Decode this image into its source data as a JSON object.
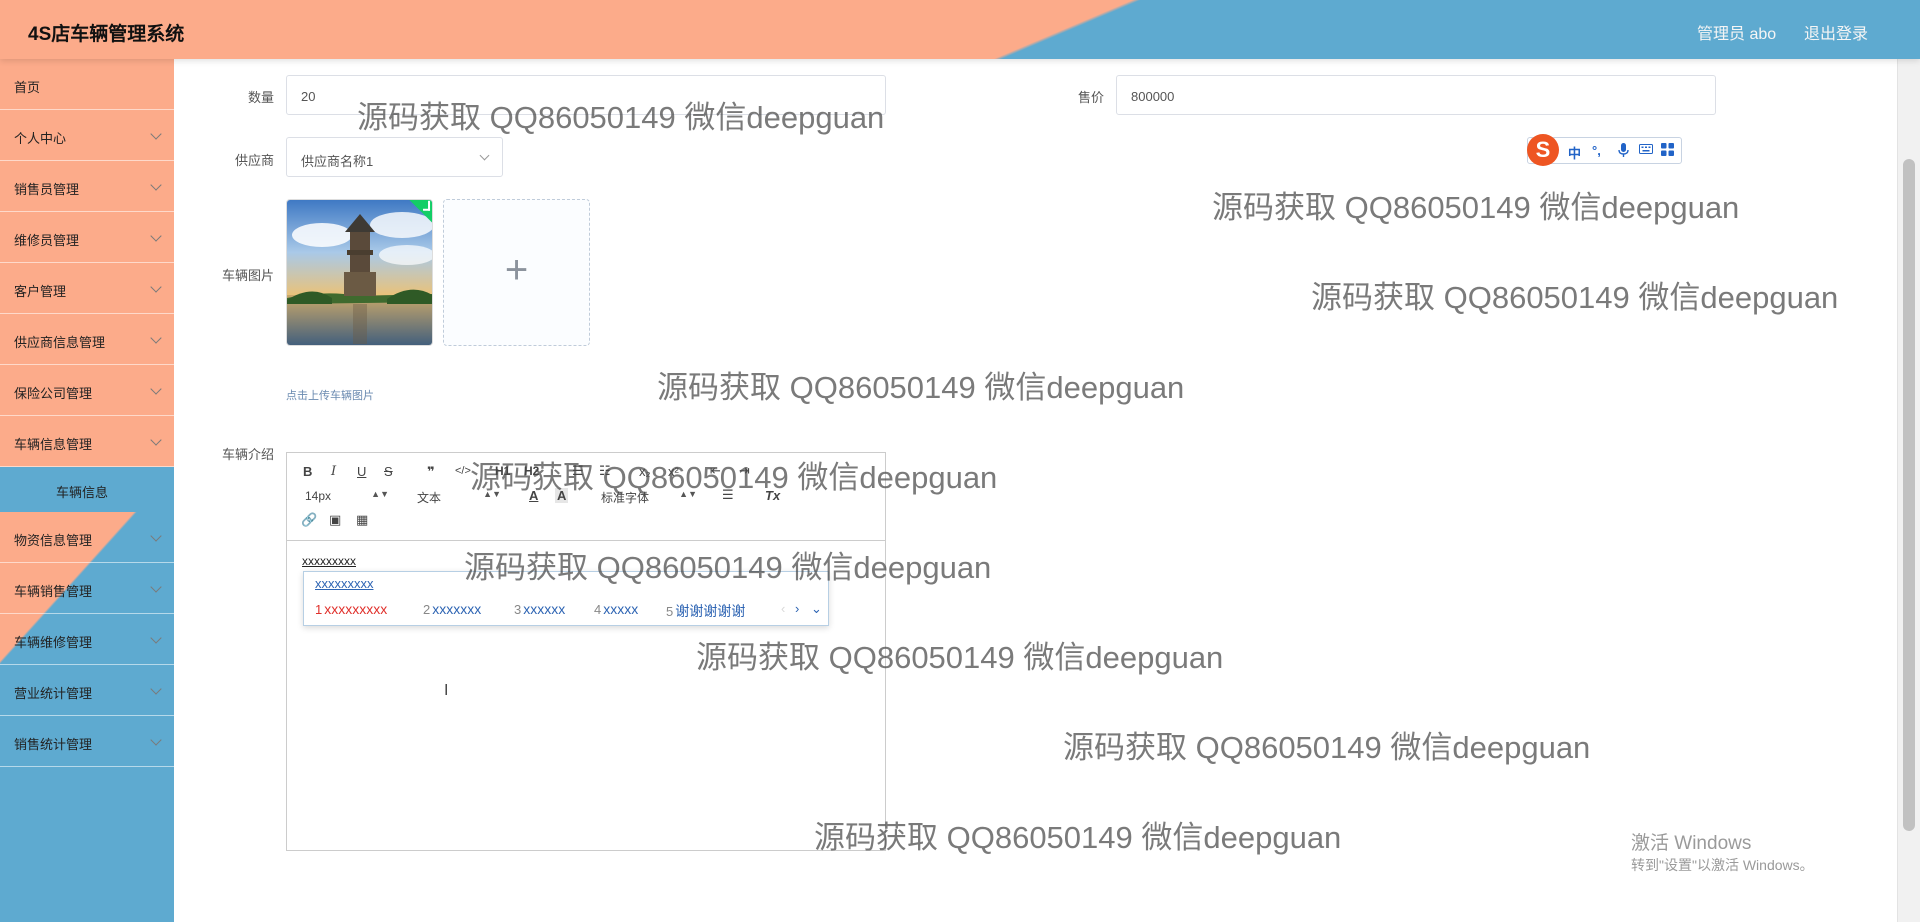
{
  "header": {
    "title": "4S店车辆管理系统",
    "user": "管理员 abo",
    "logout": "退出登录"
  },
  "sidebar": {
    "items": [
      {
        "label": "首页",
        "has_children": false
      },
      {
        "label": "个人中心",
        "has_children": true
      },
      {
        "label": "销售员管理",
        "has_children": true
      },
      {
        "label": "维修员管理",
        "has_children": true
      },
      {
        "label": "客户管理",
        "has_children": true
      },
      {
        "label": "供应商信息管理",
        "has_children": true
      },
      {
        "label": "保险公司管理",
        "has_children": true
      },
      {
        "label": "车辆信息管理",
        "has_children": true
      },
      {
        "label": "车辆信息",
        "submenu": true,
        "active": true
      },
      {
        "label": "物资信息管理",
        "has_children": true
      },
      {
        "label": "车辆销售管理",
        "has_children": true
      },
      {
        "label": "车辆维修管理",
        "has_children": true
      },
      {
        "label": "营业统计管理",
        "has_children": true
      },
      {
        "label": "销售统计管理",
        "has_children": true
      }
    ]
  },
  "form": {
    "quantity_label": "数量",
    "quantity_value": "20",
    "price_label": "售价",
    "price_value": "800000",
    "supplier_label": "供应商",
    "supplier_value": "供应商名称1",
    "image_label": "车辆图片",
    "upload_tip": "点击上传车辆图片",
    "intro_label": "车辆介绍"
  },
  "editor": {
    "toolbar": {
      "bold": "B",
      "italic": "I",
      "underline": "U",
      "strike": "S",
      "quote": "❞",
      "code": "</>",
      "h1": "H1",
      "h2": "H2",
      "ol": "☰",
      "ul": "☷",
      "sub": "x₂",
      "sup": "x²",
      "indent_left": "⇤",
      "indent_right": "⇥",
      "font_size": "14px",
      "header": "文本",
      "color": "A",
      "background": "A",
      "font_family": "标准字体",
      "align": "☰",
      "clean": "Tx",
      "link": "🔗",
      "image": "▣",
      "video": "▦"
    },
    "content": "xxxxxxxxx"
  },
  "ime": {
    "input": "xxxxxxxxx",
    "candidates": [
      {
        "num": "1",
        "text": "xxxxxxxxx",
        "active": true
      },
      {
        "num": "2",
        "text": "xxxxxxx"
      },
      {
        "num": "3",
        "text": "xxxxxx"
      },
      {
        "num": "4",
        "text": "xxxxx"
      },
      {
        "num": "5",
        "text": "谢谢谢谢谢"
      }
    ],
    "status_bar": {
      "logo": "S",
      "lang": "中",
      "punct": "°,",
      "mic": "mic-icon",
      "keyboard": "keyboard-icon",
      "toolbox": "grid-icon"
    }
  },
  "watermarks": [
    "源码获取 QQ86050149 微信deepguan",
    "源码获取 QQ86050149 微信deepguan",
    "源码获取 QQ86050149 微信deepguan",
    "源码获取 QQ86050149 微信deepguan",
    "源码获取 QQ86050149 微信deepguan",
    "源码获取 QQ86050149 微信deepguan",
    "源码获取 QQ86050149 微信deepguan",
    "源码获取 QQ86050149 微信deepguan",
    "源码获取 QQ86050149 微信deepguan",
    "源码获取 QQ86050149 微信deepguan"
  ],
  "windows_activation": {
    "line1": "激活 Windows",
    "line2": "转到\"设置\"以激活 Windows。"
  },
  "colors": {
    "header_salmon": "#fcab8a",
    "header_blue": "#5eaad0",
    "active_candidate": "#e0302b",
    "candidate_blue": "#2d64b3"
  }
}
